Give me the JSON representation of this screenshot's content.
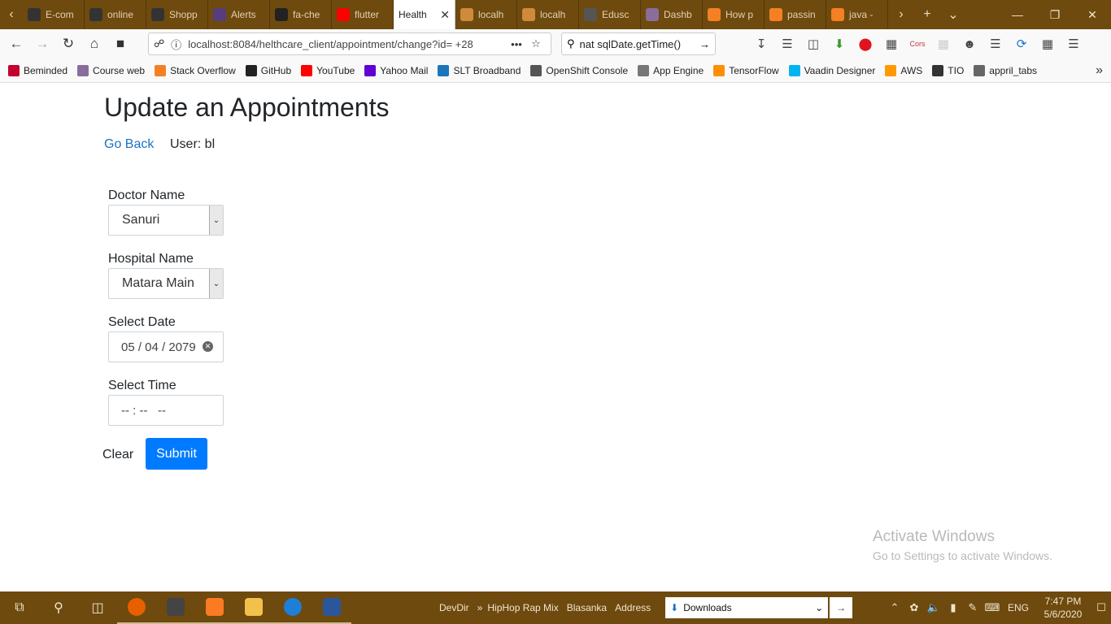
{
  "browser": {
    "tabs": [
      {
        "label": "E-com",
        "icon": "github-icon",
        "color": "#333333"
      },
      {
        "label": "online",
        "icon": "github-icon",
        "color": "#333333"
      },
      {
        "label": "Shopp",
        "icon": "github-icon",
        "color": "#333333"
      },
      {
        "label": "Alerts",
        "icon": "bootstrap-icon",
        "color": "#563d7c"
      },
      {
        "label": "fa-che",
        "icon": "fontawesome-icon",
        "color": "#222222"
      },
      {
        "label": "flutter",
        "icon": "youtube-icon",
        "color": "#ff0000"
      },
      {
        "label": "Health",
        "icon": "",
        "color": "#ffffff",
        "active": true
      },
      {
        "label": "localh",
        "icon": "warning-icon",
        "color": "#d08a3a"
      },
      {
        "label": "localh",
        "icon": "warning-icon",
        "color": "#d08a3a"
      },
      {
        "label": "Edusc",
        "icon": "play-icon",
        "color": "#555555"
      },
      {
        "label": "Dashb",
        "icon": "dashboard-icon",
        "color": "#8a6d9b"
      },
      {
        "label": "How p",
        "icon": "stackoverflow-icon",
        "color": "#f48024"
      },
      {
        "label": "passin",
        "icon": "stackoverflow-icon",
        "color": "#f48024"
      },
      {
        "label": "java -",
        "icon": "stackoverflow-icon",
        "color": "#f48024"
      }
    ],
    "url": "localhost:8084/helthcare_client/appointment/change?id= +28",
    "search_value": "nat sqlDate.getTime()",
    "bookmarks": [
      {
        "label": "Beminded",
        "color": "#c3002f"
      },
      {
        "label": "Course web",
        "color": "#8a6d9b"
      },
      {
        "label": "Stack Overflow",
        "color": "#f48024"
      },
      {
        "label": "GitHub",
        "color": "#222222"
      },
      {
        "label": "YouTube",
        "color": "#ff0000"
      },
      {
        "label": "Yahoo Mail",
        "color": "#6001d2"
      },
      {
        "label": "SLT Broadband",
        "color": "#1b75bb"
      },
      {
        "label": "OpenShift Console",
        "color": "#555555"
      },
      {
        "label": "App Engine",
        "color": "#777777"
      },
      {
        "label": "TensorFlow",
        "color": "#ff8f00"
      },
      {
        "label": "Vaadin Designer",
        "color": "#00b4f0"
      },
      {
        "label": "AWS",
        "color": "#ff9900"
      },
      {
        "label": "TIO",
        "color": "#333333"
      },
      {
        "label": "appril_tabs",
        "color": "#666666"
      }
    ]
  },
  "page": {
    "title": "Update an Appointments",
    "go_back": "Go Back",
    "user_label": "User: bl",
    "doctor": {
      "label": "Doctor Name",
      "value": "Sanuri"
    },
    "hospital": {
      "label": "Hospital Name",
      "value": "Matara Main"
    },
    "date": {
      "label": "Select Date",
      "value": "05 / 04 / 2079"
    },
    "time": {
      "label": "Select Time",
      "value": "-- : --   --"
    },
    "clear": "Clear",
    "submit": "Submit",
    "submit_color": "#007bff",
    "link_color": "#1a73c8"
  },
  "watermark": {
    "line1": "Activate Windows",
    "line2": "Go to Settings to activate Windows."
  },
  "taskbar": {
    "links": [
      "DevDir",
      "HipHop Rap Mix",
      "Blasanka",
      "Address"
    ],
    "address_value": "Downloads",
    "language": "ENG",
    "time": "7:47 PM",
    "date": "5/6/2020"
  }
}
